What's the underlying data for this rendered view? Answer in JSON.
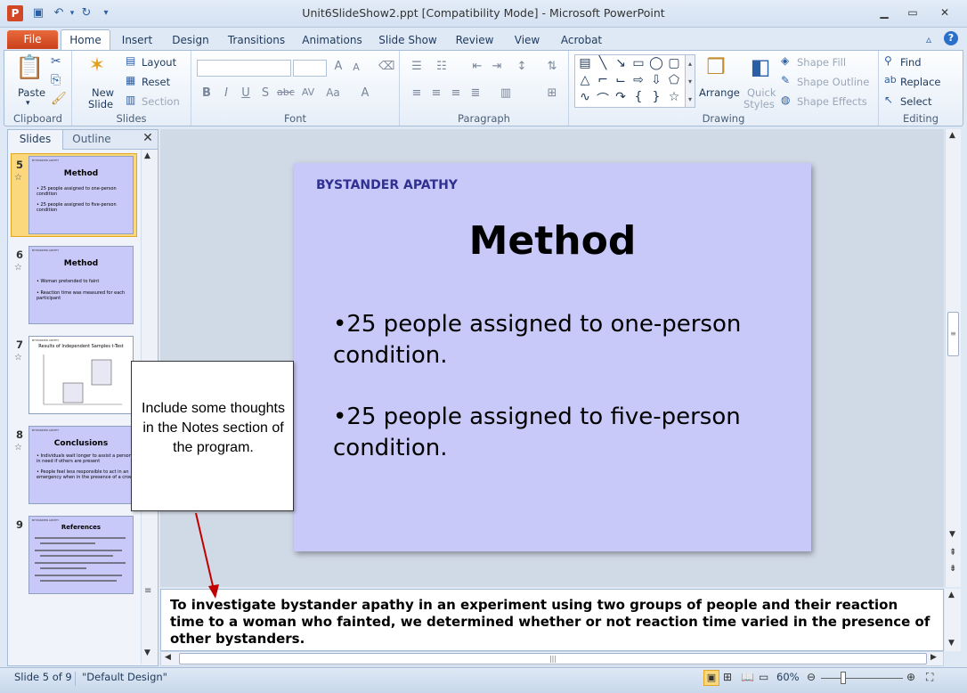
{
  "window": {
    "title": "Unit6SlideShow2.ppt [Compatibility Mode]  -  Microsoft PowerPoint",
    "app_icon_letter": "P"
  },
  "ribbon_tabs": [
    "File",
    "Home",
    "Insert",
    "Design",
    "Transitions",
    "Animations",
    "Slide Show",
    "Review",
    "View",
    "Acrobat"
  ],
  "ribbon": {
    "clipboard": {
      "label": "Clipboard",
      "paste": "Paste"
    },
    "slides": {
      "label": "Slides",
      "new_slide": "New",
      "new_slide_2": "Slide",
      "layout": "Layout",
      "reset": "Reset",
      "section": "Section"
    },
    "font": {
      "label": "Font"
    },
    "paragraph": {
      "label": "Paragraph"
    },
    "drawing": {
      "label": "Drawing",
      "arrange": "Arrange",
      "quick_styles": "Quick",
      "quick_styles_2": "Styles",
      "shape_fill": "Shape Fill",
      "shape_outline": "Shape Outline",
      "shape_effects": "Shape Effects"
    },
    "editing": {
      "label": "Editing",
      "find": "Find",
      "replace": "Replace",
      "select": "Select"
    }
  },
  "panel": {
    "tab_slides": "Slides",
    "tab_outline": "Outline",
    "thumbnails": [
      {
        "num": "5",
        "title": "Method",
        "bullets": [
          "• 25 people assigned to one-person condition",
          "• 25 people assigned to five-person condition"
        ]
      },
      {
        "num": "6",
        "title": "Method",
        "bullets": [
          "• Woman pretended to faint",
          "• Reaction time was measured for each participant"
        ]
      },
      {
        "num": "7",
        "title": "Results of Independent Samples t-Test",
        "bullets": []
      },
      {
        "num": "8",
        "title": "Conclusions",
        "bullets": [
          "• Individuals wait longer to assist a person in need if others are present",
          "• People feel less responsible to act in an emergency when in the presence of a crowd"
        ]
      },
      {
        "num": "9",
        "title": "References",
        "bullets": []
      }
    ]
  },
  "slide": {
    "header": "BYSTANDER APATHY",
    "title": "Method",
    "bullets": [
      "•25 people assigned to one-person condition.",
      "•25 people assigned to five-person condition."
    ]
  },
  "callout": {
    "text": "Include some thoughts in the Notes section of the program."
  },
  "notes": {
    "text": "To investigate bystander apathy in an experiment using two groups of people and their reaction time to a woman who fainted, we determined whether or not reaction time varied in the presence of other bystanders."
  },
  "status": {
    "slide_info": "Slide 5 of 9",
    "theme": "\"Default Design\"",
    "zoom": "60%"
  },
  "colors": {
    "slide_bg": "#c9c9f9",
    "header": "#2f3091",
    "file_tab": "#c9401b",
    "arrow": "#c00000"
  }
}
